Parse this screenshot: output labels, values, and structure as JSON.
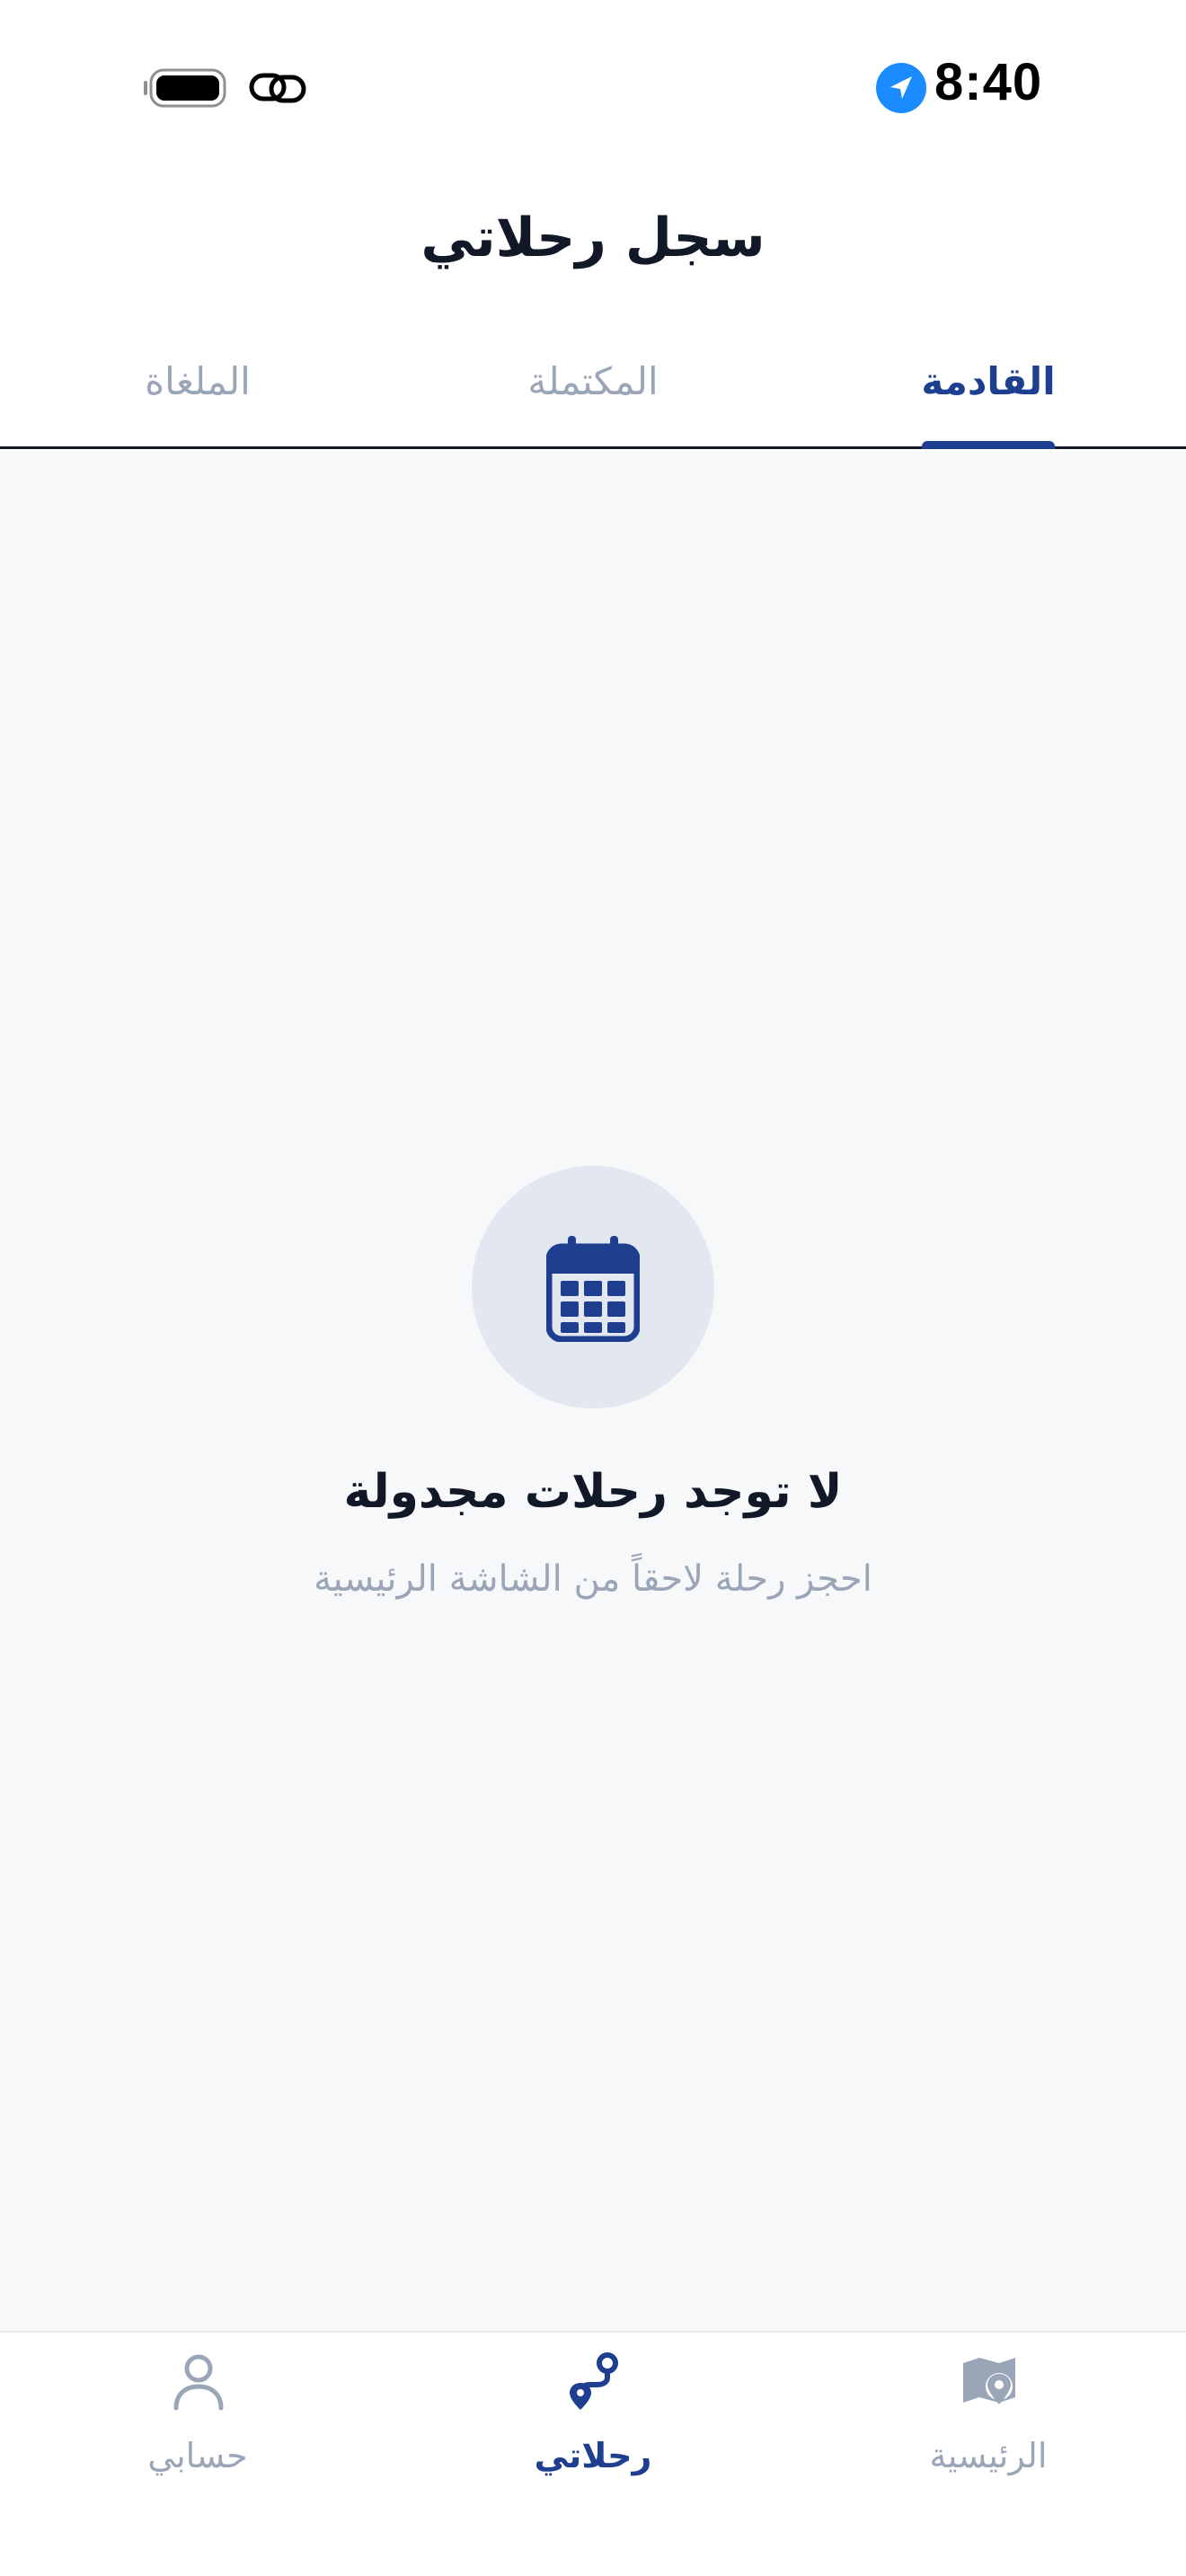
{
  "status_bar": {
    "time": "8:40"
  },
  "header": {
    "title": "سجل رحلاتي"
  },
  "tabs": [
    {
      "label": "القادمة",
      "active": true
    },
    {
      "label": "المكتملة",
      "active": false
    },
    {
      "label": "الملغاة",
      "active": false
    }
  ],
  "empty_state": {
    "icon": "calendar-icon",
    "title": "لا توجد رحلات مجدولة",
    "subtitle": "احجز رحلة لاحقاً من الشاشة الرئيسية"
  },
  "bottom_nav": {
    "items": [
      {
        "label": "الرئيسية",
        "icon": "map-pin-icon",
        "active": false
      },
      {
        "label": "رحلاتي",
        "icon": "route-icon",
        "active": true
      },
      {
        "label": "حسابي",
        "icon": "user-icon",
        "active": false
      }
    ]
  },
  "colors": {
    "accent": "#1e3f8f",
    "muted": "#9aa6b8",
    "text": "#111827",
    "content_bg": "#f7f8fa",
    "location_blue": "#1a8cff"
  }
}
